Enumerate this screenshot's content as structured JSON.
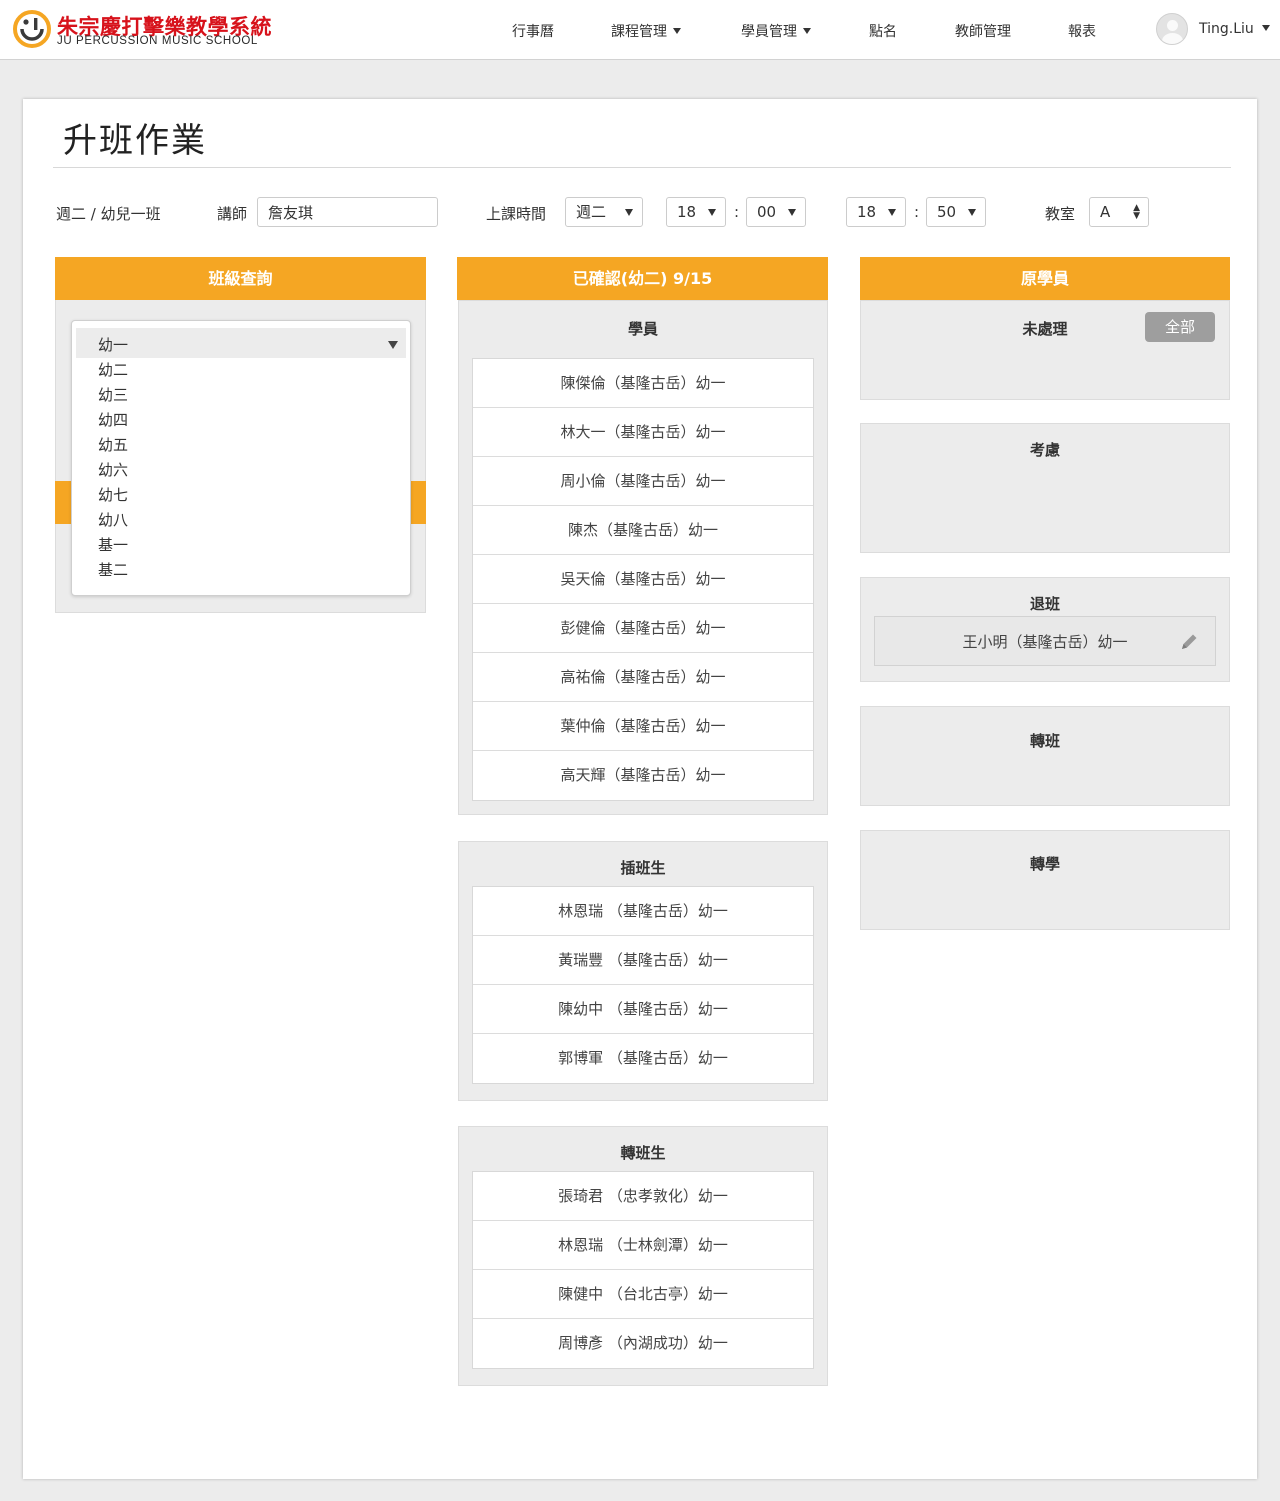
{
  "brand": {
    "name_cn": "朱宗慶打擊樂教學系統",
    "name_en": "JU PERCUSSION MUSIC SCHOOL",
    "accent": "#f5a623",
    "red": "#d7121b"
  },
  "nav": {
    "items": [
      {
        "label": "行事曆",
        "dropdown": false
      },
      {
        "label": "課程管理",
        "dropdown": true
      },
      {
        "label": "學員管理",
        "dropdown": true
      },
      {
        "label": "點名",
        "dropdown": false
      },
      {
        "label": "教師管理",
        "dropdown": false
      },
      {
        "label": "報表",
        "dropdown": false
      }
    ],
    "user": "Ting.Liu"
  },
  "page": {
    "title": "升班作業"
  },
  "filters": {
    "class_name": "週二 / 幼兒一班",
    "teacher_label": "講師",
    "teacher_value": "詹友琪",
    "time_label": "上課時間",
    "day": "週二",
    "start_hour": "18",
    "start_min": "00",
    "end_hour": "18",
    "end_min": "50",
    "colon": ":",
    "room_label": "教室",
    "room": "A"
  },
  "class_query": {
    "header": "班級查詢",
    "selected": "幼一",
    "options": [
      "幼二",
      "幼三",
      "幼四",
      "幼五",
      "幼六",
      "幼七",
      "幼八",
      "基一",
      "基二"
    ]
  },
  "confirmed": {
    "header": "已確認(幼二) 9/15",
    "students_title": "學員",
    "students": [
      "陳傑倫（基隆古岳）幼一",
      "林大一（基隆古岳）幼一",
      "周小倫（基隆古岳）幼一",
      "陳杰（基隆古岳）幼一",
      "吳天倫（基隆古岳）幼一",
      "彭健倫（基隆古岳）幼一",
      "高祐倫（基隆古岳）幼一",
      "葉仲倫（基隆古岳）幼一",
      "高天輝（基隆古岳）幼一"
    ],
    "insert_title": "插班生",
    "insert": [
      "林恩瑞 （基隆古岳）幼一",
      "黃瑞豐 （基隆古岳）幼一",
      "陳幼中 （基隆古岳）幼一",
      "郭博軍 （基隆古岳）幼一"
    ],
    "transfer_title": "轉班生",
    "transfer": [
      "張琦君 （忠孝敦化）幼一",
      "林恩瑞 （士林劍潭）幼一",
      "陳健中 （台北古亭）幼一",
      "周博彥 （內湖成功）幼一"
    ]
  },
  "original": {
    "header": "原學員",
    "pending_title": "未處理",
    "all_button": "全部",
    "consider_title": "考慮",
    "withdraw_title": "退班",
    "withdraw_item": "王小明（基隆古岳）幼一",
    "switch_title": "轉班",
    "transfer_school_title": "轉學"
  }
}
